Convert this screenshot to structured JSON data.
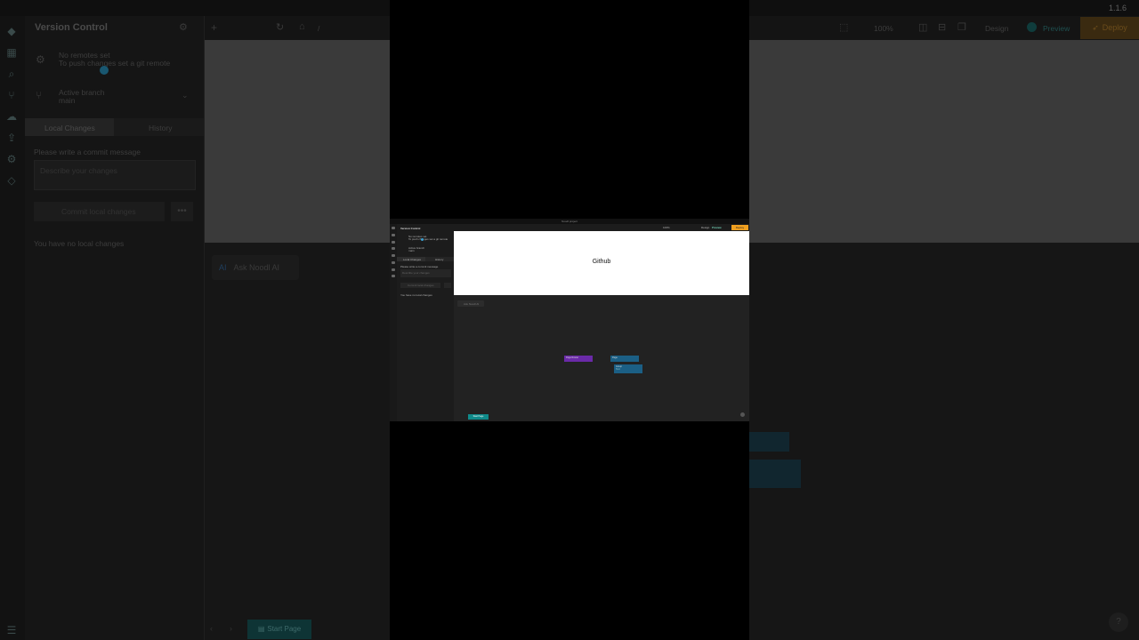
{
  "background_app": {
    "version": "1.1.6",
    "panel_title": "Version Control",
    "remote_status": "No remotes set",
    "remote_hint": "To push changes set a git remote",
    "branch_label": "Active branch",
    "branch_name": "main",
    "tab_local": "Local Changes",
    "tab_history": "History",
    "commit_prompt": "Please write a commit message",
    "commit_placeholder": "Describe your changes",
    "commit_button": "Commit local changes",
    "no_changes": "You have no local changes",
    "zoom": "100%",
    "design_label": "Design",
    "preview_label": "Preview",
    "deploy_label": "Deploy",
    "ai_chip": "Ask Noodl AI",
    "ai_badge": "AI",
    "start_page": "Start Page",
    "breadcrumb": "/",
    "help": "?"
  },
  "mini_app": {
    "window_title": "Noodl project",
    "panel_title": "Version Control",
    "remote_status": "No remotes set",
    "remote_hint": "To push changes set a git remote",
    "branch_label": "Active branch",
    "branch_name": "main",
    "tab_local": "Local Changes",
    "tab_history": "History",
    "commit_prompt": "Please write a commit message",
    "commit_placeholder": "Describe your changes",
    "commit_button": "Commit local changes",
    "no_changes": "You have no local changes",
    "canvas_text": "Github",
    "ai_chip": "Ask Noodl AI",
    "zoom": "100%",
    "design_label": "Design",
    "preview_label": "Preview",
    "deploy_label": "Deploy",
    "node_page_router": "Page Router",
    "node_page": "Page",
    "node_group": "Group",
    "node_group_sub": "Text",
    "start_page": "Start Page"
  },
  "colors": {
    "deploy": "#f0a020",
    "preview": "#18b4b4",
    "page_router_node": "#6a2aa8",
    "page_node": "#1b5f85",
    "start_page": "#0f8a8a"
  }
}
